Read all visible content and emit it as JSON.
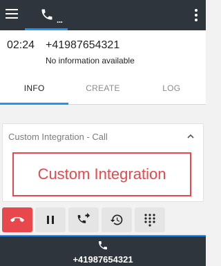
{
  "header": {
    "call_tab_dots": "..."
  },
  "call": {
    "timer": "02:24",
    "number": "+41987654321",
    "info": "No information available"
  },
  "tabs": [
    {
      "label": "INFO",
      "active": true
    },
    {
      "label": "CREATE",
      "active": false
    },
    {
      "label": "LOG",
      "active": false
    }
  ],
  "integration": {
    "title": "Custom Integration - Call",
    "content": "Custom Integration"
  },
  "actions": {
    "icons": [
      "hangup-icon",
      "pause-icon",
      "transfer-icon",
      "history-icon",
      "dialpad-icon"
    ]
  },
  "bottom": {
    "number": "+41987654321"
  },
  "colors": {
    "bar": "#2f353c",
    "accent": "#1e90ff",
    "danger": "#e8474b"
  }
}
